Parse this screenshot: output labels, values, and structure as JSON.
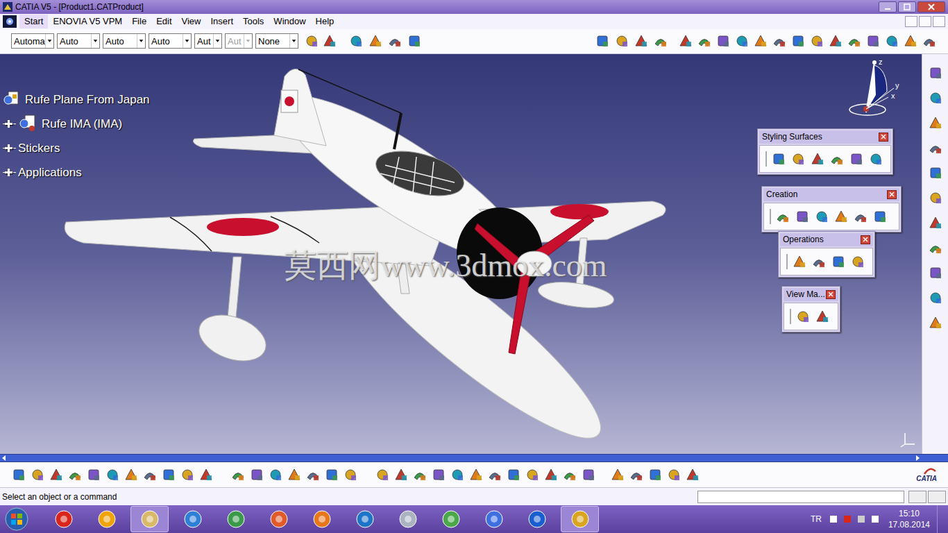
{
  "window": {
    "title": "CATIA V5 - [Product1.CATProduct]"
  },
  "menu": {
    "items": [
      "Start",
      "ENOVIA V5 VPM",
      "File",
      "Edit",
      "View",
      "Insert",
      "Tools",
      "Window",
      "Help"
    ]
  },
  "toolbar": {
    "dropdowns": [
      {
        "value": "Automa",
        "disabled": false
      },
      {
        "value": "Auto",
        "disabled": false
      },
      {
        "value": "Auto",
        "disabled": false
      },
      {
        "value": "Auto",
        "disabled": false
      },
      {
        "value": "Aut",
        "disabled": false
      },
      {
        "value": "Aut",
        "disabled": true
      },
      {
        "value": "None",
        "disabled": false
      }
    ]
  },
  "tree": {
    "items": [
      {
        "label": "Rufe Plane From Japan",
        "kind": "root",
        "expanded": false
      },
      {
        "label": "Rufe IMA (IMA)",
        "kind": "product",
        "expanded": false
      },
      {
        "label": "Stickers",
        "kind": "node",
        "expanded": false
      },
      {
        "label": "Applications",
        "kind": "node",
        "expanded": false
      }
    ]
  },
  "watermark": "莫西网www.3dmox.com",
  "compass": {
    "axes": [
      "z",
      "y",
      "x"
    ]
  },
  "floating_toolbars": [
    {
      "title": "Styling Surfaces"
    },
    {
      "title": "Creation"
    },
    {
      "title": "Operations"
    },
    {
      "title": "View Ma..."
    }
  ],
  "status_bar": {
    "message": "Select an object or a command"
  },
  "brand": "CATIA",
  "taskbar": {
    "language": "TR",
    "time": "15:10",
    "date": "17.08.2014"
  }
}
